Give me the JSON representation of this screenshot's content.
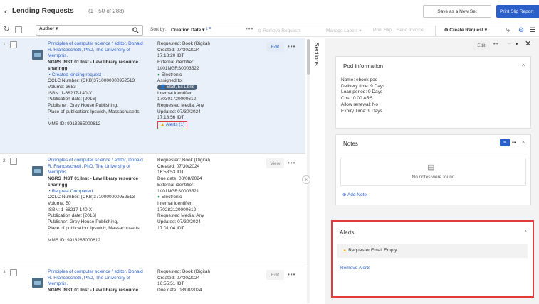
{
  "header": {
    "back_icon": "‹",
    "title": "Lending Requests",
    "count": "(1 - 50 of 288)",
    "save_as_new_set": "Save as a New Set",
    "print_slip_report": "Print Slip Report"
  },
  "toolbar": {
    "refresh_icon": "↻",
    "author_dropdown": "Author ▾",
    "search_icon": "search-icon",
    "sort_label": "Sort by:",
    "sort_value": "Creation Date ▾",
    "sort_dir_icon": "↓≡",
    "more_dots": "•••",
    "remove_requests": "⊖ Remove Requests",
    "manage_labels": "Manage Labels ▾",
    "print_slip": "Print Slip",
    "send_invoice": "Send Invoice",
    "create_request": "⊕ Create Request ▾",
    "icon1": "⤷",
    "icon2": "⚙",
    "icon3": "☰"
  },
  "records": [
    {
      "num": "1",
      "title": "Principles of computer science / editor, Donald R. Franceschetti, PhD, The University of Memphis.",
      "institution": "NGRS INST 01 Inst - Law library resource sharingg",
      "status": "Created lending request",
      "oclc": "OCLC Number: (CKB)3710000000952513",
      "volume": "Volume: 3653",
      "isbn": "ISBN: 1-68217-140-X",
      "pubdate": "Publication date: [2016]",
      "publisher": "Publisher: Grey House Publishing,",
      "place": "Place of publication: Ipswich, Massachusetts",
      "colon": ":",
      "mms": "MMS ID: 9913265000612",
      "requested": "Requested: Book (Digital)",
      "created": "Created: 07/30/2024",
      "created_time": "17:18:20 IDT",
      "ext_label": "External identifier:",
      "ext_id": "1//01NGRS0003522",
      "mode": "Electronic",
      "assigned_label": "Assigned to:",
      "assigned": "Staff, Ex Libris",
      "int_label": "Internal identifier:",
      "int_id": "170301720000612",
      "media": "Requested Media: Any",
      "updated": "Updated: 07/30/2024",
      "updated_time": "17:18:56 IDT",
      "alerts_link": "Alerts (1)",
      "action": "Edit"
    },
    {
      "num": "2",
      "title": "Principles of computer science / editor, Donald R. Franceschetti, PhD, The University of Memphis.",
      "institution": "NGRS INST 01 Inst - Law library resource sharingg",
      "status": "Request Completed",
      "oclc": "OCLC Number: (CKB)3710000000952513",
      "volume": "Volume: 50",
      "isbn": "ISBN: 1-68217-140-X",
      "pubdate": "Publication date: [2016]",
      "publisher": "Publisher: Grey House Publishing,",
      "place": "Place of publication: Ipswich, Massachusetts",
      "colon": ":",
      "mms": "MMS ID: 9913265000612",
      "requested": "Requested: Book (Digital)",
      "created": "Created: 07/30/2024",
      "created_time": "16:58:53 IDT",
      "due": "Due date: 08/08/2024",
      "ext_label": "External identifier:",
      "ext_id": "1//01NGRS0003521",
      "mode": "Electronic",
      "int_label": "Internal identifier:",
      "int_id": "170282120000612",
      "media": "Requested Media: Any",
      "updated": "Updated: 07/30/2024",
      "updated_time": "17:01:04 IDT",
      "action": "View"
    },
    {
      "num": "3",
      "title": "Principles of computer science / editor, Donald R. Franceschetti, PhD, The University of Memphis.",
      "institution": "NGRS INST 01 Inst - Law library resource",
      "requested": "Requested: Book (Digital)",
      "created": "Created: 07/30/2024",
      "created_time": "16:55:51 IDT",
      "due": "Due date: 08/08/2024",
      "action": "Edit"
    }
  ],
  "sections_label": "Sections",
  "collapse_icon": "«",
  "panel": {
    "edit": "Edit",
    "dots": "•••",
    "dash": "–",
    "down": "▾",
    "close": "✕",
    "pod_title": "Pod information",
    "pod_lines": [
      "Name: ebook pod",
      "Delivery time: 9 Days",
      "Loan period: 9 Days",
      "Cost: 0.00 ARS",
      "Allow renewal: No",
      "Expiry Time: 9 Days"
    ],
    "notes_title": "Notes",
    "no_notes": "No notes were found",
    "add_note": "Add Note",
    "alerts_title": "Alerts",
    "alert_text": "Requester Email Empty",
    "remove_alerts": "Remove Alerts",
    "chevron": "^"
  }
}
